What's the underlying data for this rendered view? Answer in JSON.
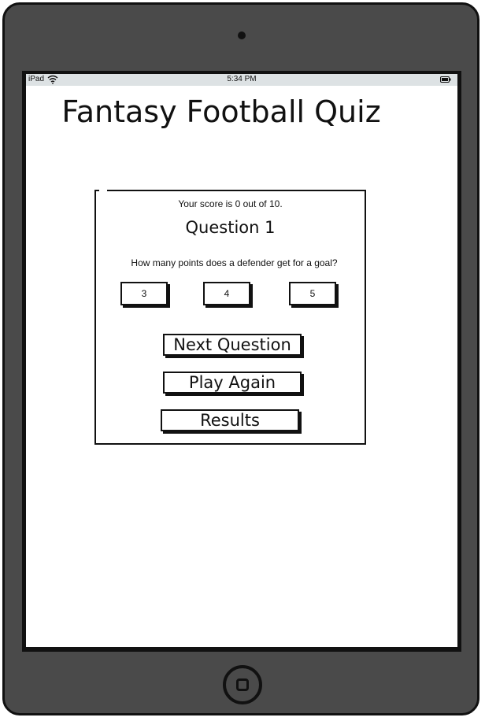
{
  "status_bar": {
    "carrier": "iPad",
    "time": "5:34 PM"
  },
  "page": {
    "title": "Fantasy Football Quiz"
  },
  "quiz": {
    "score_text": "Your score is 0 out of 10.",
    "question_title": "Question 1",
    "question_text": "How many points does a defender get for a goal?",
    "answers": [
      "3",
      "4",
      "5"
    ],
    "buttons": {
      "next": "Next Question",
      "play_again": "Play Again",
      "results": "Results"
    }
  },
  "icons": {
    "wifi": "wifi-icon",
    "battery": "battery-icon",
    "camera": "camera-icon",
    "home": "home-button-icon"
  }
}
